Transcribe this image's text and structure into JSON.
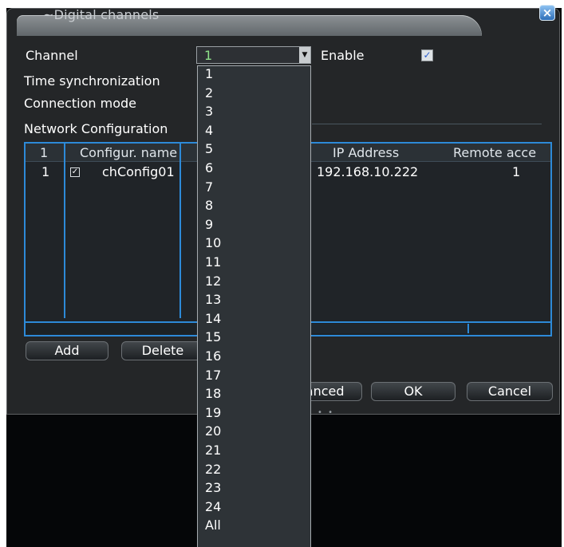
{
  "window": {
    "title": "~Digital channels",
    "close_label": "×"
  },
  "form": {
    "channel_label": "Channel",
    "channel_value": "1",
    "enable_label": "Enable",
    "enable_checked": true,
    "time_sync_label": "Time synchronization",
    "connection_mode_label": "Connection mode",
    "network_config_label": "Network Configuration"
  },
  "table": {
    "columns": [
      "1",
      "Configur. name",
      "IP Address",
      "Remote acce"
    ],
    "rows": [
      {
        "index": "1",
        "checked": true,
        "name": "chConfig01",
        "ip": "192.168.10.222",
        "remote": "1"
      }
    ]
  },
  "buttons": {
    "add": "Add",
    "delete": "Delete",
    "advanced": "Advanced",
    "ok": "OK",
    "cancel": "Cancel"
  },
  "dropdown_options": [
    "1",
    "2",
    "3",
    "4",
    "5",
    "6",
    "7",
    "8",
    "9",
    "10",
    "11",
    "12",
    "13",
    "14",
    "15",
    "16",
    "17",
    "18",
    "19",
    "20",
    "21",
    "22",
    "23",
    "24",
    "All"
  ],
  "colors": {
    "accent_blue": "#2d8ad8",
    "selected_value_green": "#8ee28a",
    "dialog_bg": "#242628"
  }
}
